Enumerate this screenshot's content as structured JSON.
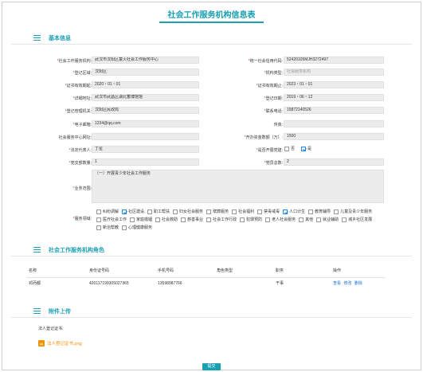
{
  "page": {
    "title": "社会工作服务机构信息表"
  },
  "sections": {
    "basic": "基本信息",
    "roles": "社会工作服务机构角色",
    "attachments": "附件上传"
  },
  "form": {
    "org_name": {
      "label": "社会工作服务机构:",
      "value": "武汉市汉阳区童火社会工作服务中心"
    },
    "credit_code": {
      "label": "统一社会信用代码:",
      "value": "52420105MJH3272497"
    },
    "reg_area": {
      "label": "登记区域:",
      "value": "汉阳区"
    },
    "org_type": {
      "label": "机构类型:",
      "value": "社会服务机构"
    },
    "cert_start": {
      "label": "证书有效期起:",
      "value": "2020・01・01"
    },
    "cert_end": {
      "label": "证书有效期止:",
      "value": "2023・01・01"
    },
    "address": {
      "label": "详细地址:",
      "value": "武汉市武昌区湖北蓄博馆馆"
    },
    "reg_date": {
      "label": "登记日期:",
      "value": "2019・06・12"
    },
    "reg_authority": {
      "label": "登记管理机关:",
      "value": "汉阳区民政局"
    },
    "phone": {
      "label": "联系电话:",
      "value": "15872140526"
    },
    "email": {
      "label": "电子邮箱:",
      "value": "1234@qq.com"
    },
    "fax": {
      "label": "传真:",
      "value": ""
    },
    "website": {
      "label": "社会服务中心网址:",
      "value": ""
    },
    "capital": {
      "label": "开办资金数额（万）:",
      "value": "1500"
    },
    "legal_rep": {
      "label": "法定代表人:",
      "value": "丁星"
    },
    "party_branch": {
      "label": "是否开展党建:",
      "no": "否",
      "yes": "是",
      "selected": "是"
    },
    "party_branches": {
      "label": "党支部数量:",
      "value": "1"
    },
    "party_members": {
      "label": "党员总数:",
      "value": "2"
    },
    "business_scope": {
      "label": "业务范围:",
      "value": "（一）开展青少年社会工作服务"
    },
    "service_area": {
      "label": "服务领域:",
      "rows": [
        [
          {
            "name": "纠纷调解",
            "checked": false
          },
          {
            "name": "社区建设",
            "checked": true
          },
          {
            "name": "职工帮扶",
            "checked": false
          },
          {
            "name": "妇女社会服务",
            "checked": false
          },
          {
            "name": "殡葬服务",
            "checked": false
          },
          {
            "name": "社会福利",
            "checked": false
          },
          {
            "name": "禁毒戒毒",
            "checked": false
          },
          {
            "name": "人口计生",
            "checked": true
          },
          {
            "name": "教育辅导",
            "checked": false
          },
          {
            "name": "儿童及青少年服务",
            "checked": false
          }
        ],
        [
          {
            "name": "医疗社会工作",
            "checked": false
          },
          {
            "name": "家庭婚姻",
            "checked": false
          },
          {
            "name": "社会救助",
            "checked": false
          },
          {
            "name": "慈善事业",
            "checked": false
          },
          {
            "name": "社会工作行政",
            "checked": false
          },
          {
            "name": "犯罪预防",
            "checked": false
          },
          {
            "name": "老人社会服务",
            "checked": false
          },
          {
            "name": "其他",
            "checked": false
          },
          {
            "name": "就业辅助",
            "checked": false
          },
          {
            "name": "城乡社区发展",
            "checked": false
          }
        ],
        [
          {
            "name": "新治帮教",
            "checked": false
          },
          {
            "name": "心理健康服务",
            "checked": false
          }
        ]
      ]
    }
  },
  "roles_table": {
    "headers": [
      "名称",
      "身份证号码",
      "手机号码",
      "角色类型",
      "职务",
      "操作"
    ],
    "rows": [
      {
        "name": "邓而都",
        "id": "420117199305027365",
        "mobile": "13598987766",
        "role_type": "",
        "position": "干事",
        "actions": [
          "查看",
          "修改",
          "删除"
        ]
      }
    ]
  },
  "attachments": {
    "label": "法人登记证书:",
    "file_icon": "AI",
    "file_name": "法人登记证书.png"
  },
  "footer": {
    "submit_label": "提交"
  }
}
